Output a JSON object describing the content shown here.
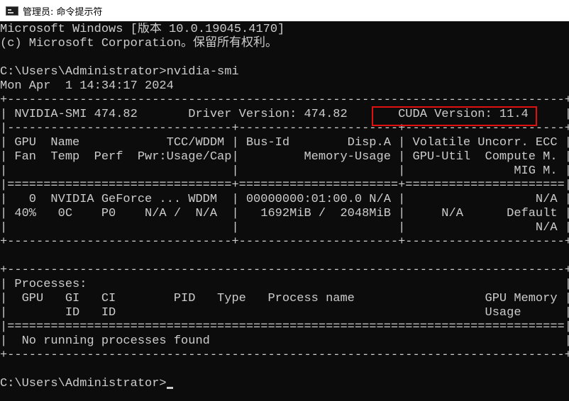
{
  "window": {
    "title": "管理员: 命令提示符",
    "icon": "cmd-console-icon"
  },
  "console": {
    "lines": [
      "Microsoft Windows [版本 10.0.19045.4170]",
      "(c) Microsoft Corporation。保留所有权利。",
      "",
      "C:\\Users\\Administrator>nvidia-smi",
      "Mon Apr  1 14:34:17 2024",
      "+-----------------------------------------------------------------------------+",
      "| NVIDIA-SMI 474.82       Driver Version: 474.82       CUDA Version: 11.4     |",
      "|-------------------------------+----------------------+----------------------+",
      "| GPU  Name            TCC/WDDM | Bus-Id        Disp.A | Volatile Uncorr. ECC |",
      "| Fan  Temp  Perf  Pwr:Usage/Cap|         Memory-Usage | GPU-Util  Compute M. |",
      "|                               |                      |               MIG M. |",
      "|===============================+======================+======================|",
      "|   0  NVIDIA GeForce ... WDDM  | 00000000:01:00.0 N/A |                  N/A |",
      "| 40%   0C    P0    N/A /  N/A  |   1692MiB /  2048MiB |     N/A      Default |",
      "|                               |                      |                  N/A |",
      "+-------------------------------+----------------------+----------------------+",
      "",
      "+-----------------------------------------------------------------------------+",
      "| Processes:                                                                  |",
      "|  GPU   GI   CI        PID   Type   Process name                  GPU Memory |",
      "|        ID   ID                                                   Usage      |",
      "|=============================================================================|",
      "|  No running processes found                                                 |",
      "+-----------------------------------------------------------------------------+",
      "",
      "C:\\Users\\Administrator>"
    ]
  },
  "highlight": {
    "label": "CUDA Version: 11.4",
    "color": "#e01010"
  },
  "colors": {
    "background": "#0c0c0c",
    "text": "#cccccc",
    "titlebar": "#ffffff"
  }
}
